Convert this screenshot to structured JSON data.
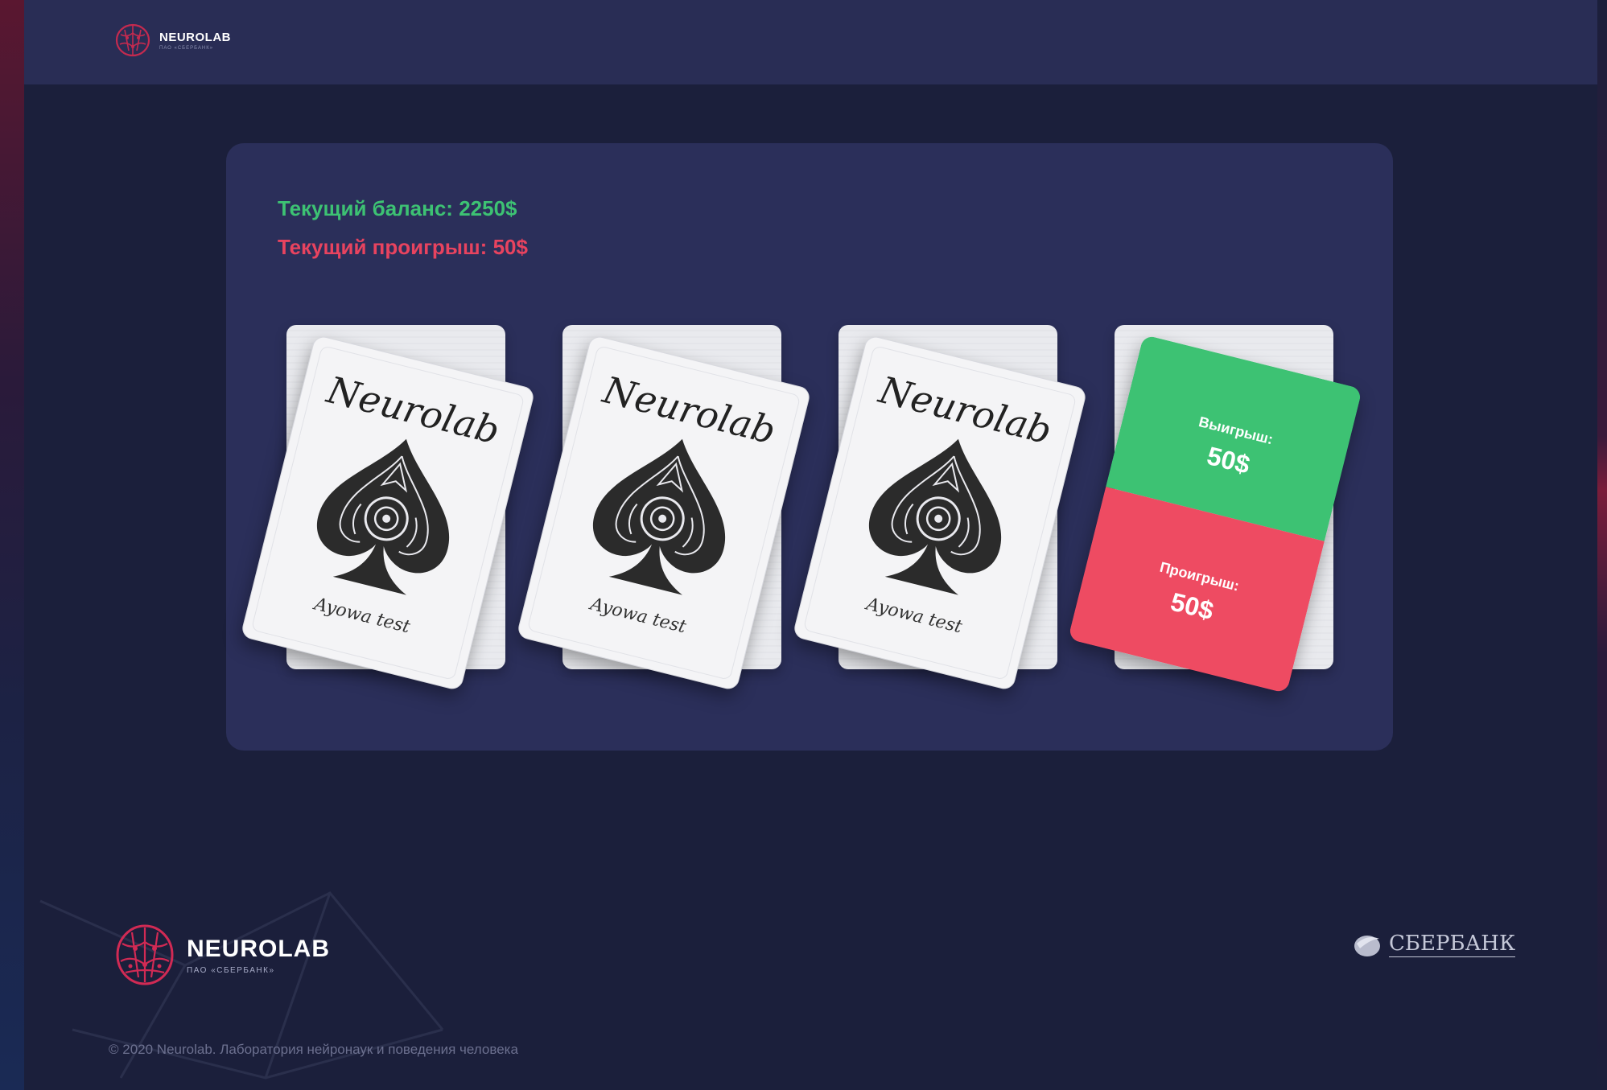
{
  "header": {
    "brand": "NEUROLAB",
    "brand_sub": "ПАО «СБЕРБАНК»"
  },
  "status": {
    "balance": "Текущий баланс: 2250$",
    "loss": "Текущий проигрыш: 50$"
  },
  "decks": [
    {
      "title": "Neurolab",
      "subtitle": "Ayowa test"
    },
    {
      "title": "Neurolab",
      "subtitle": "Ayowa test"
    },
    {
      "title": "Neurolab",
      "subtitle": "Ayowa test"
    }
  ],
  "result": {
    "win_label": "Выигрыш:",
    "win_value": "50$",
    "lose_label": "Проигрыш:",
    "lose_value": "50$"
  },
  "footer": {
    "brand": "NEUROLAB",
    "brand_sub": "ПАО «СБЕРБАНК»",
    "partner": "СБЕРБАНК",
    "copyright": "© 2020 Neurolab. Лаборатория нейронаук и поведения человека"
  },
  "colors": {
    "balance": "#3dc273",
    "loss": "#e8435f",
    "win": "#3dc273",
    "lose": "#ee4b62",
    "background": "#1b1f3b",
    "panel": "#2b2f5a"
  }
}
